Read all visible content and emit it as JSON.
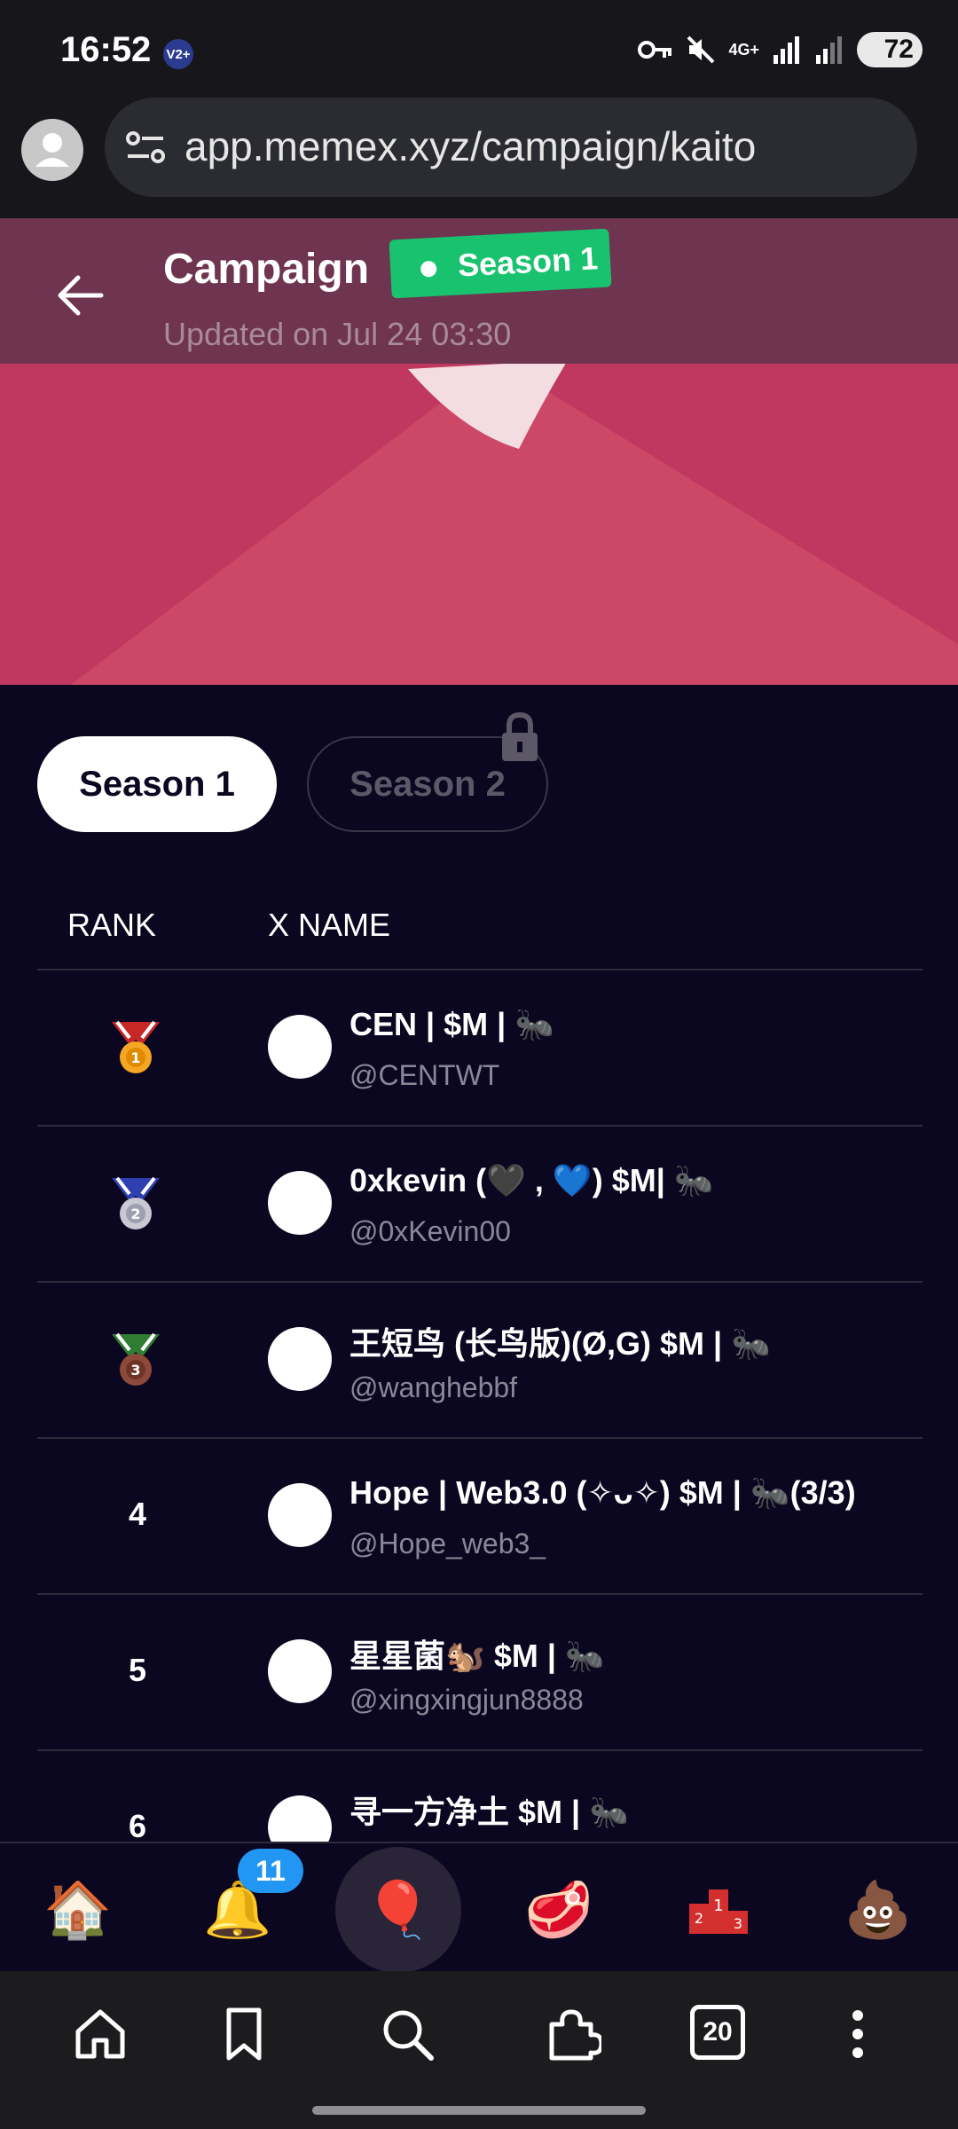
{
  "status_bar": {
    "time": "16:52",
    "vpn_badge": "V2+",
    "battery": "72",
    "network": "4G+"
  },
  "browser": {
    "url": "app.memex.xyz/campaign/kaito",
    "tab_count": "20"
  },
  "header": {
    "title": "Campaign",
    "season_chip": "Season 1",
    "updated": "Updated on Jul 24 03:30"
  },
  "tabs": {
    "season1": "Season 1",
    "season2": "Season 2"
  },
  "table": {
    "rank_header": "RANK",
    "name_header": "X NAME",
    "rows": [
      {
        "rank": "1",
        "medal": "gold-medal-icon",
        "name": "CEN | $M | 🐜",
        "handle": "@CENTWT"
      },
      {
        "rank": "2",
        "medal": "silver-medal-icon",
        "name": "0xkevin (🖤 , 💙) $M| 🐜",
        "handle": "@0xKevin00"
      },
      {
        "rank": "3",
        "medal": "bronze-medal-icon",
        "name": "王短鸟 (长鸟版)(Ø,G) $M | 🐜",
        "handle": "@wanghebbf"
      },
      {
        "rank": "4",
        "name": "Hope | Web3.0 (✧ᴗ✧) $M | 🐜(3/3)",
        "handle": "@Hope_web3_"
      },
      {
        "rank": "5",
        "name": "星星菌🐿️ $M | 🐜",
        "handle": "@xingxingjun8888"
      },
      {
        "rank": "6",
        "name": "寻一方净土 $M | 🐜",
        "handle": ""
      }
    ]
  },
  "app_nav": {
    "notifications_badge": "11",
    "icons": [
      "house-icon",
      "bell-icon",
      "hot-air-balloon-icon",
      "meat-icon",
      "podium-icon",
      "poop-icon"
    ]
  },
  "colors": {
    "background": "#0c0720",
    "accent_green": "#18c26e",
    "hero": "#c0385f",
    "badge_blue": "#2196f3"
  }
}
